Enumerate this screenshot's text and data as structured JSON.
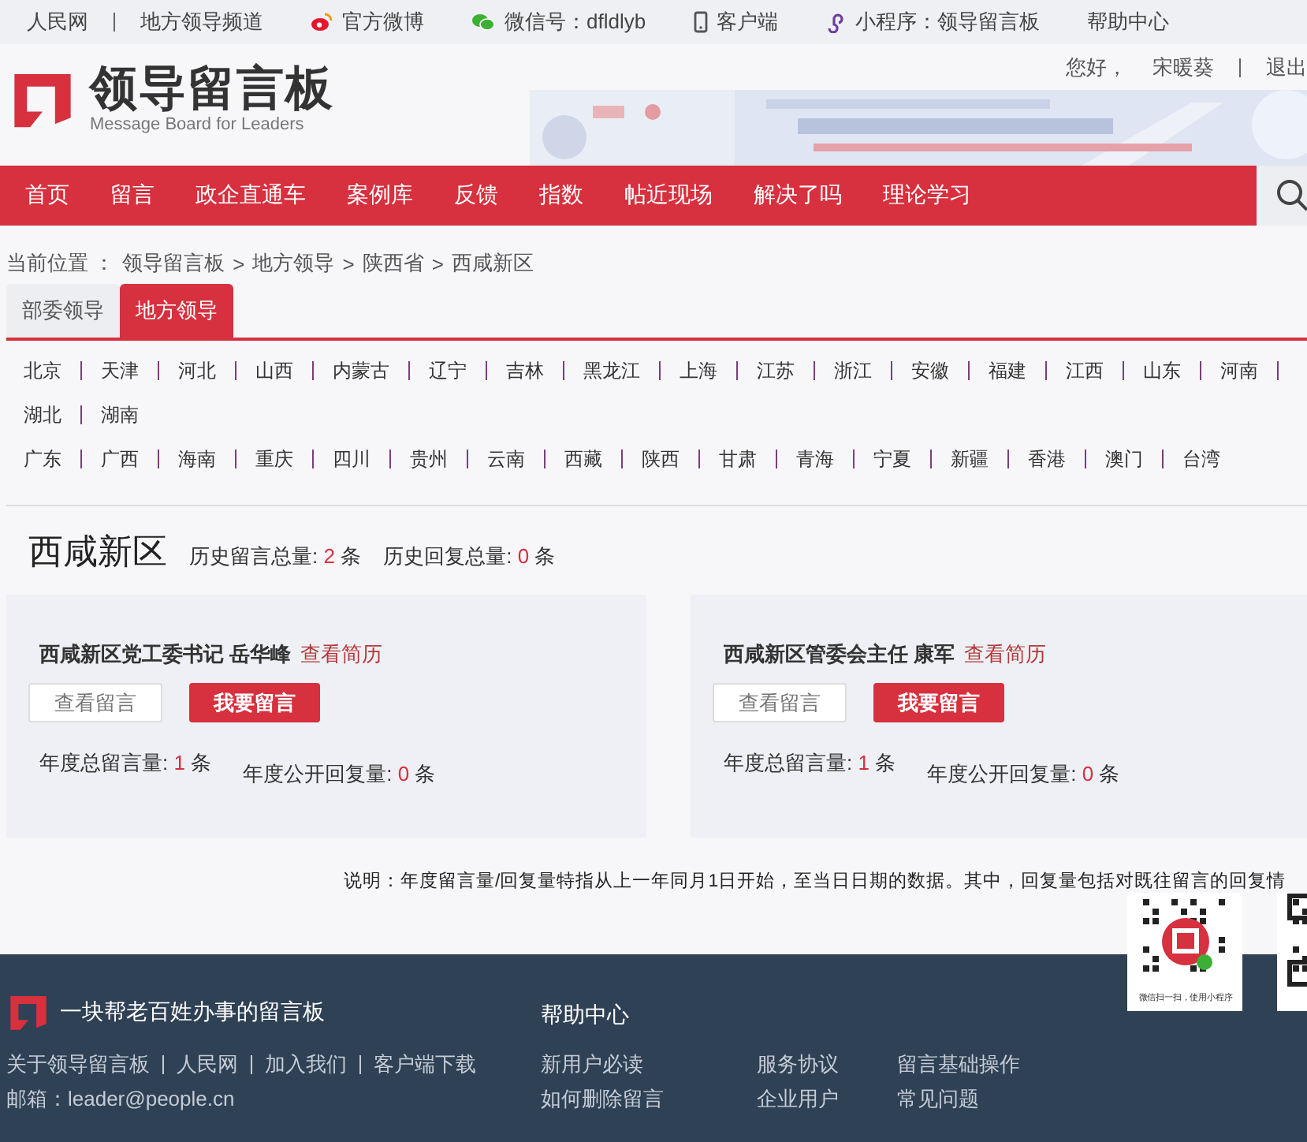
{
  "top_bar": {
    "links": [
      {
        "label": "人民网",
        "kind": "plain"
      },
      {
        "label": "地方领导频道",
        "kind": "plain"
      },
      {
        "label": "官方微博",
        "kind": "weibo"
      },
      {
        "label": "微信号：dfldlyb",
        "kind": "wechat"
      },
      {
        "label": "客户端",
        "kind": "phone"
      },
      {
        "label": "小程序：领导留言板",
        "kind": "miniprogram"
      },
      {
        "label": "帮助中心",
        "kind": "plain"
      }
    ]
  },
  "header": {
    "logo_title": "领导留言板",
    "logo_subtitle": "Message Board for Leaders",
    "greeting": "您好，",
    "username": "宋暖葵",
    "logout": "退出"
  },
  "nav": {
    "items": [
      "首页",
      "留言",
      "政企直通车",
      "案例库",
      "反馈",
      "指数",
      "帖近现场",
      "解决了吗",
      "理论学习"
    ]
  },
  "breadcrumb": {
    "label": "当前位置 ：",
    "separator": ">",
    "items": [
      "领导留言板",
      "地方领导",
      "陕西省",
      "西咸新区"
    ]
  },
  "tabs": [
    {
      "label": "部委领导",
      "selected": false
    },
    {
      "label": "地方领导",
      "selected": true
    }
  ],
  "province_groups": [
    [
      "北京",
      "天津",
      "河北",
      "山西",
      "内蒙古",
      "辽宁",
      "吉林",
      "黑龙江",
      "上海",
      "江苏",
      "浙江",
      "安徽",
      "福建",
      "江西",
      "山东",
      "河南",
      "湖北",
      "湖南"
    ],
    [
      "广东",
      "广西",
      "海南",
      "重庆",
      "四川",
      "贵州",
      "云南",
      "西藏",
      "陕西",
      "甘肃",
      "青海",
      "宁夏",
      "新疆",
      "香港",
      "澳门",
      "台湾"
    ]
  ],
  "region": {
    "name": "西咸新区",
    "stats": [
      {
        "label": "历史留言总量:",
        "value": "2",
        "unit": "条"
      },
      {
        "label": "历史回复总量:",
        "value": "0",
        "unit": "条"
      }
    ]
  },
  "leaders": [
    {
      "title": "西咸新区党工委书记 岳华峰",
      "resume_link": "查看简历",
      "view_button": "查看留言",
      "post_button": "我要留言",
      "stats": [
        {
          "label": "年度总留言量:",
          "value": "1",
          "unit": "条"
        },
        {
          "label": "年度公开回复量:",
          "value": "0",
          "unit": "条"
        }
      ]
    },
    {
      "title": "西咸新区管委会主任 康军",
      "resume_link": "查看简历",
      "view_button": "查看留言",
      "post_button": "我要留言",
      "stats": [
        {
          "label": "年度总留言量:",
          "value": "1",
          "unit": "条"
        },
        {
          "label": "年度公开回复量:",
          "value": "0",
          "unit": "条"
        }
      ]
    }
  ],
  "note": "说明：年度留言量/回复量特指从上一年同月1日开始，至当日日期的数据。其中，回复量包括对既往留言的回复情",
  "qr_codes": [
    {
      "kind": "miniprogram",
      "caption": "微信扫一扫，使用小程序"
    },
    {
      "kind": "app"
    }
  ],
  "footer": {
    "slogan": "一块帮老百姓办事的留言板",
    "links": [
      "关于领导留言板",
      "人民网",
      "加入我们",
      "客户端下载"
    ],
    "email": "邮箱：leader@people.cn",
    "help_title": "帮助中心",
    "help_links": [
      "新用户必读",
      "服务协议",
      "留言基础操作",
      "如何删除留言",
      "企业用户",
      "常见问题"
    ]
  }
}
